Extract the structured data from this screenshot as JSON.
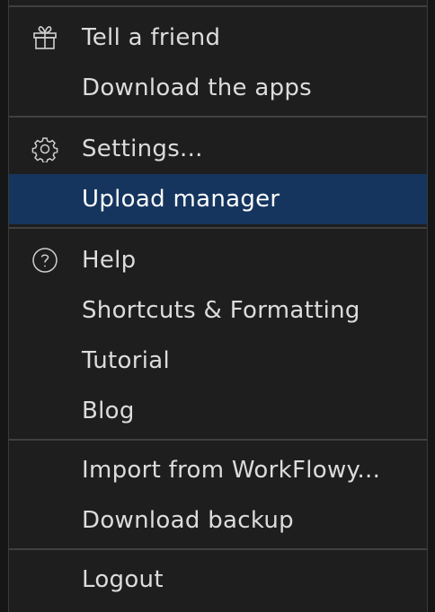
{
  "menu": {
    "items": [
      {
        "label": "Tell a friend",
        "icon": "gift-icon"
      },
      {
        "label": "Download the apps"
      },
      {
        "label": "Settings...",
        "icon": "gear-icon"
      },
      {
        "label": "Upload manager",
        "active": true
      },
      {
        "label": "Help",
        "icon": "help-icon"
      },
      {
        "label": "Shortcuts & Formatting"
      },
      {
        "label": "Tutorial"
      },
      {
        "label": "Blog"
      },
      {
        "label": "Import from WorkFlowy..."
      },
      {
        "label": "Download backup"
      },
      {
        "label": "Logout"
      }
    ],
    "active_color": "#15355f",
    "background_color": "#1e1e1e"
  }
}
